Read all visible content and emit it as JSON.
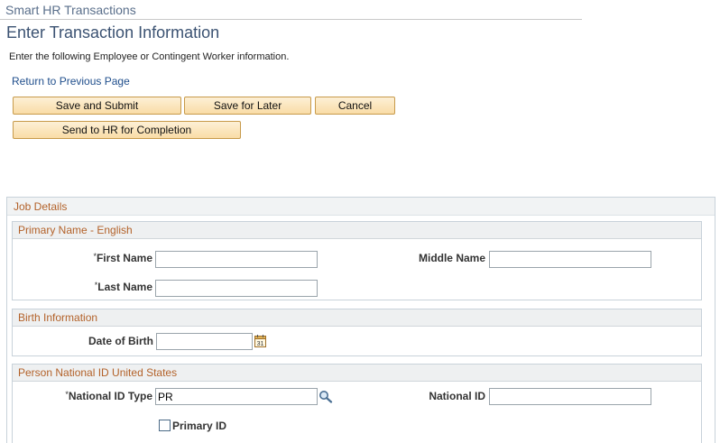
{
  "app": {
    "title": "Smart HR Transactions"
  },
  "page": {
    "title": "Enter Transaction Information",
    "instructions": "Enter the following Employee or Contingent Worker information.",
    "return_link": "Return to Previous Page"
  },
  "toolbar": {
    "save_submit": "Save and Submit",
    "save_later": "Save for Later",
    "cancel": "Cancel",
    "send_hr": "Send to HR for Completion"
  },
  "job_details": {
    "header": "Job Details",
    "primary_name": {
      "header": "Primary Name - English",
      "first_name_label": "First Name",
      "first_name_value": "",
      "middle_name_label": "Middle Name",
      "middle_name_value": "",
      "last_name_label": "Last Name",
      "last_name_value": ""
    },
    "birth": {
      "header": "Birth Information",
      "dob_label": "Date of Birth",
      "dob_value": "",
      "calendar_icon_text": "31"
    },
    "national_id": {
      "header": "Person National ID United States",
      "type_label": "National ID Type",
      "type_value": "PR",
      "id_label": "National ID",
      "id_value": "",
      "primary_label": "Primary ID",
      "primary_checked": false
    }
  },
  "required_marker": "*",
  "icons": {
    "calendar": "calendar-icon",
    "lookup": "magnifier-lookup-icon"
  },
  "colors": {
    "accent_title": "#3b5272",
    "section_header_text": "#b3622a",
    "button_fill": "#f9dca6",
    "link": "#1f4e8c"
  }
}
